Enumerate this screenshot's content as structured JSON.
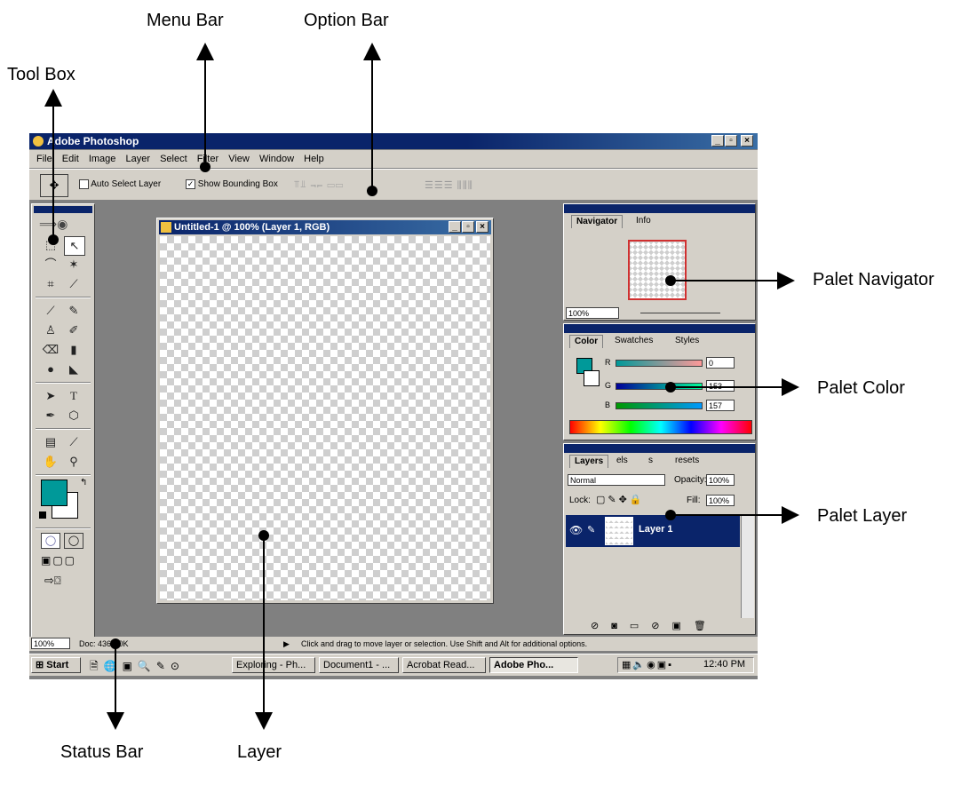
{
  "annotations": {
    "menu_bar": "Menu Bar",
    "option_bar": "Option Bar",
    "tool_box": "Tool Box",
    "palet_navigator": "Palet Navigator",
    "palet_color": "Palet Color",
    "palet_layer": "Palet Layer",
    "status_bar": "Status Bar",
    "layer": "Layer"
  },
  "window": {
    "title": "Adobe Photoshop",
    "menus": [
      "File",
      "Edit",
      "Image",
      "Layer",
      "Select",
      "Filter",
      "View",
      "Window",
      "Help"
    ]
  },
  "options": {
    "auto_select": "Auto Select Layer",
    "show_bbox": "Show Bounding Box",
    "show_bbox_checked": true,
    "auto_select_checked": false
  },
  "document": {
    "title": "Untitled-1 @ 100% (Layer 1, RGB)"
  },
  "navigator": {
    "tabs": [
      "Navigator",
      "Info"
    ],
    "zoom": "100%"
  },
  "color": {
    "tabs": [
      "Color",
      "Swatches",
      "Styles"
    ],
    "r_label": "R",
    "g_label": "G",
    "b_label": "B",
    "r": "0",
    "g": "153",
    "b": "157",
    "foreground": "#009999"
  },
  "layers": {
    "tabs": [
      "Layers",
      "els",
      "",
      "s",
      "resets"
    ],
    "blend_mode": "Normal",
    "opacity_label": "Opacity:",
    "opacity": "100%",
    "lock_label": "Lock:",
    "fill_label": "Fill:",
    "fill": "100%",
    "layer_name": "Layer 1"
  },
  "status": {
    "zoom": "100%",
    "doc": "Doc: 436K/0K",
    "hint": "Click and drag to move layer or selection.  Use Shift and Alt for additional options."
  },
  "taskbar": {
    "start": "Start",
    "items": [
      "Exploring - Ph...",
      "Document1 - ...",
      "Acrobat Read...",
      "Adobe Pho..."
    ],
    "clock": "12:40 PM"
  }
}
